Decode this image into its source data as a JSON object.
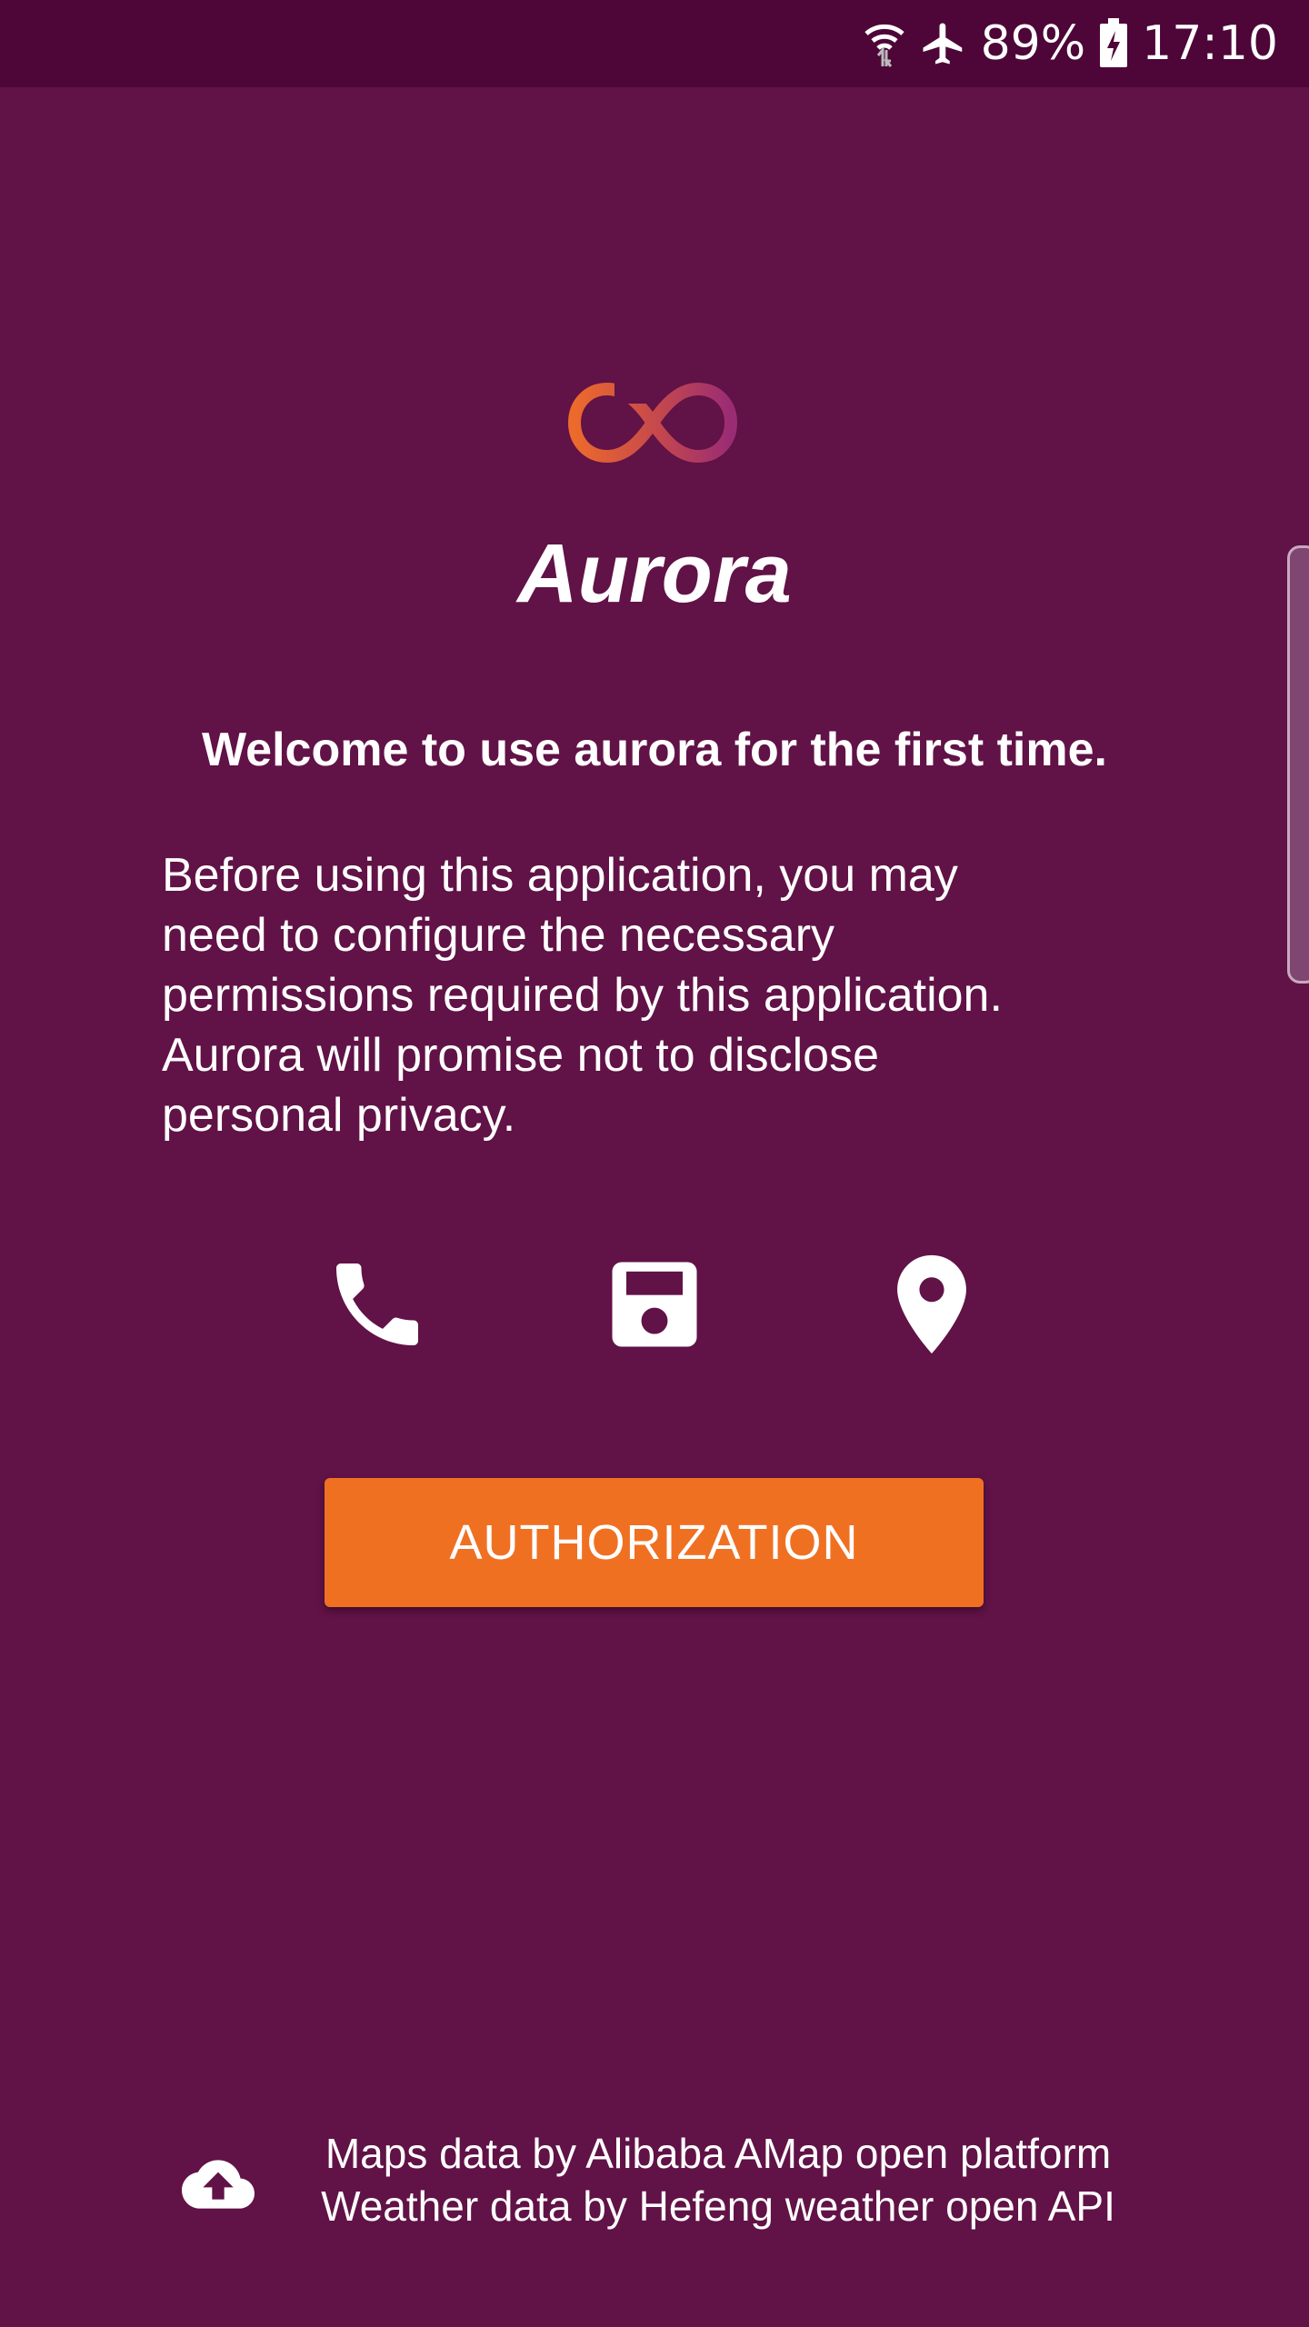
{
  "status_bar": {
    "battery_percent": "89%",
    "time": "17:10",
    "icons": [
      "wifi-icon",
      "airplane-mode-icon",
      "battery-charging-icon"
    ]
  },
  "app": {
    "logo_icon": "infinity-logo-icon",
    "title": "Aurora"
  },
  "welcome_text": "Welcome to use aurora for the first time.",
  "description": " Before using this application, you may\nneed to configure the necessary\npermissions required by this application.\nAurora will promise not to disclose\npersonal privacy.",
  "permissions": [
    {
      "icon": "phone-icon"
    },
    {
      "icon": "storage-icon"
    },
    {
      "icon": "location-icon"
    }
  ],
  "authorization_button": {
    "label": "AUTHORIZATION",
    "color": "#f07022"
  },
  "footer": {
    "icon": "cloud-upload-icon",
    "line1": "Maps data by Alibaba AMap open platform",
    "line2": "Weather data by Hefeng weather open API"
  },
  "colors": {
    "background": "#611246",
    "status_bar": "#4e0538",
    "accent": "#f07022"
  }
}
